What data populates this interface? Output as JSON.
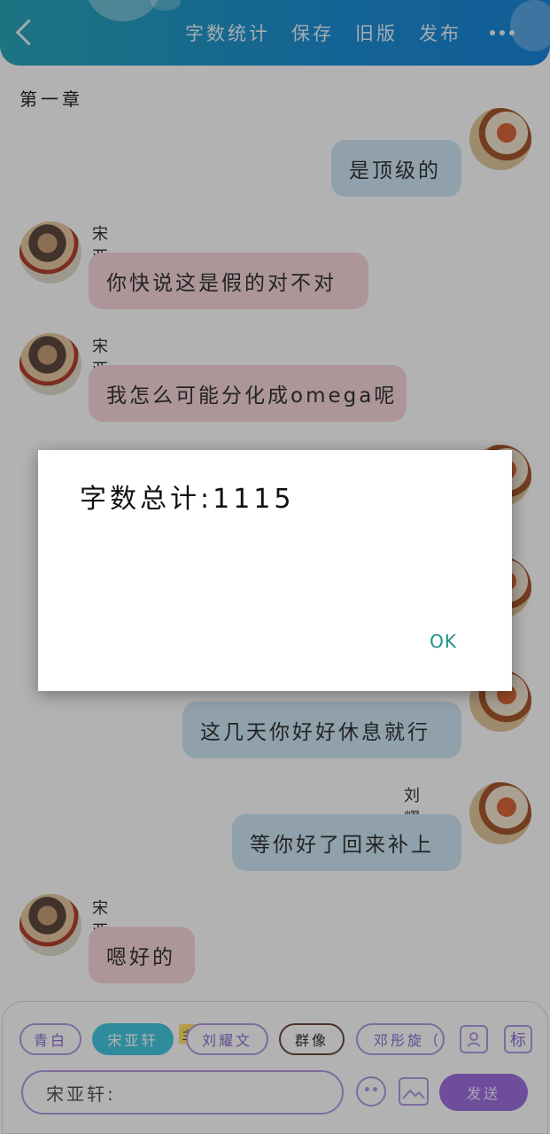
{
  "topbar": {
    "word_count_label": "字数统计",
    "save_label": "保存",
    "old_version_label": "旧版",
    "publish_label": "发布"
  },
  "chapter_title": "第一章",
  "messages": [
    {
      "side": "right",
      "name": "",
      "text": "是顶级的"
    },
    {
      "side": "left",
      "name": "宋亚轩",
      "text": "你快说这是假的对不对"
    },
    {
      "side": "left",
      "name": "宋亚轩",
      "text": "我怎么可能分化成omega呢"
    },
    {
      "side": "right",
      "name": "",
      "text": "这几天你好好休息就行"
    },
    {
      "side": "right",
      "name": "刘耀文",
      "text": "等你好了回来补上"
    },
    {
      "side": "left",
      "name": "宋亚轩",
      "text": "嗯好的"
    }
  ],
  "roles": {
    "items": [
      "青白",
      "宋亚轩",
      "刘耀文",
      "群像",
      "邓彤旋（"
    ],
    "host_badge": "主",
    "tag_icon_label": "标"
  },
  "input": {
    "value": "宋亚轩:",
    "send_label": "发送"
  },
  "dialog": {
    "message": "字数总计:1115",
    "ok_label": "OK"
  },
  "colors": {
    "topbar_start": "#2aa6b8",
    "topbar_end": "#1a86db",
    "left_bubble": "#f7d7dc",
    "right_bubble": "#cfe7f7",
    "accent_purple": "#9c6fe0",
    "active_chip": "#46c7e0",
    "ok_color": "#1f8f86"
  },
  "icons": [
    "back-arrow-icon",
    "more-icon",
    "person-icon",
    "emoji-icon",
    "image-icon"
  ]
}
